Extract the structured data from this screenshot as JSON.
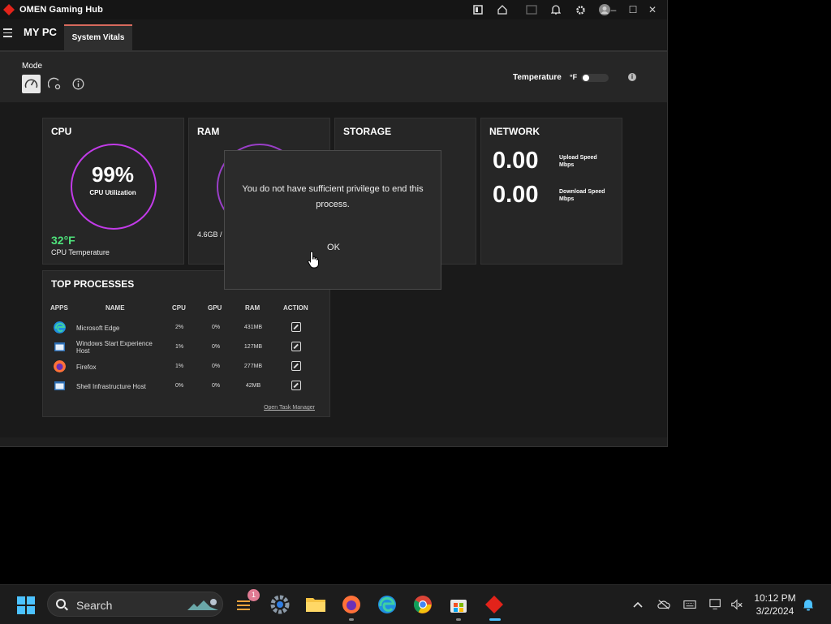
{
  "window": {
    "title": "OMEN Gaming Hub",
    "controls": [
      "–",
      "☐",
      "✕"
    ]
  },
  "nav": {
    "title": "MY PC",
    "tab": "System Vitals"
  },
  "modebar": {
    "label": "Mode",
    "temperature_label": "Temperature",
    "temperature_unit": "°F",
    "info": "i"
  },
  "cpu": {
    "title": "CPU",
    "utilization": "99%",
    "utilization_label": "CPU Utilization",
    "temperature": "32°F",
    "temperature_label": "CPU Temperature",
    "ring_color": "#c23be8"
  },
  "ram": {
    "title": "RAM",
    "usage_text": "4.6GB /"
  },
  "storage": {
    "title": "STORAGE"
  },
  "network": {
    "title": "NETWORK",
    "upload_value": "0.00",
    "upload_label_1": "Upload Speed",
    "upload_label_2": "Mbps",
    "download_value": "0.00",
    "download_label_1": "Download Speed",
    "download_label_2": "Mbps"
  },
  "processes": {
    "title": "TOP PROCESSES",
    "headers": {
      "apps": "APPS",
      "name": "NAME",
      "cpu": "CPU",
      "gpu": "GPU",
      "ram": "RAM",
      "action": "ACTION"
    },
    "rows": [
      {
        "icon": "edge-icon",
        "name": "Microsoft Edge",
        "cpu": "2%",
        "gpu": "0%",
        "ram": "431MB"
      },
      {
        "icon": "app-window-icon",
        "name": "Windows Start Experience Host",
        "cpu": "1%",
        "gpu": "0%",
        "ram": "127MB"
      },
      {
        "icon": "firefox-icon",
        "name": "Firefox",
        "cpu": "1%",
        "gpu": "0%",
        "ram": "277MB"
      },
      {
        "icon": "app-window-icon",
        "name": "Shell Infrastructure Host",
        "cpu": "0%",
        "gpu": "0%",
        "ram": "42MB"
      }
    ],
    "task_manager_link": "Open Task Manager"
  },
  "dialog": {
    "message": "You do not have sufficient privilege to end this process.",
    "ok_label": "OK"
  },
  "taskbar": {
    "search_placeholder": "Search",
    "widgets_badge": "1",
    "clock_time": "10:12 PM",
    "clock_date": "3/2/2024"
  },
  "colors": {
    "accent": "#d86a5d",
    "cpu_temp": "#4ee27b",
    "taskbar_accent": "#4cc2ff"
  }
}
